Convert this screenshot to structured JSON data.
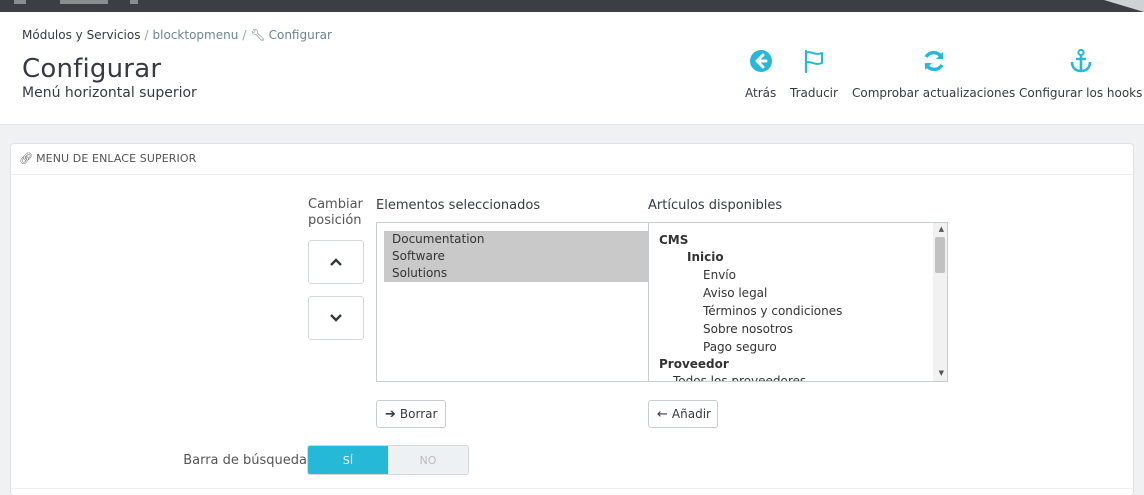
{
  "breadcrumb": {
    "root": "Módulos y Servicios",
    "module": "blocktopmenu",
    "current": "Configurar",
    "separator": "/"
  },
  "header": {
    "title": "Configurar",
    "subtitle": "Menú horizontal superior"
  },
  "toolbar": [
    {
      "label": "Atrás",
      "icon": "back-circle-icon"
    },
    {
      "label": "Traducir",
      "icon": "flag-icon"
    },
    {
      "label": "Comprobar actualizaciones",
      "icon": "refresh-icon"
    },
    {
      "label": "Configurar los hooks",
      "icon": "anchor-icon"
    }
  ],
  "panel": {
    "heading": "MENU DE ENLACE SUPERIOR",
    "position_label_1": "Cambiar",
    "position_label_2": "posición",
    "selected_title": "Elementos seleccionados",
    "available_title": "Artículos disponibles",
    "selected_items": [
      "Documentation",
      "Software",
      "Solutions"
    ],
    "available_items": [
      {
        "text": "CMS"
      },
      {
        "text": "Inicio"
      },
      {
        "text": "Envío"
      },
      {
        "text": "Aviso legal"
      },
      {
        "text": "Términos y condiciones"
      },
      {
        "text": "Sobre nosotros"
      },
      {
        "text": "Pago seguro"
      },
      {
        "text": "Proveedor"
      },
      {
        "text": "Todos los proveedores"
      }
    ],
    "remove_button": "Borrar",
    "add_button": "Añadir",
    "search_bar_label": "Barra de búsqueda",
    "switch_on": "SÍ",
    "switch_off": "NO"
  },
  "colors": {
    "accent": "#25b9d7",
    "text": "#363a41",
    "background": "#eff1f2"
  }
}
